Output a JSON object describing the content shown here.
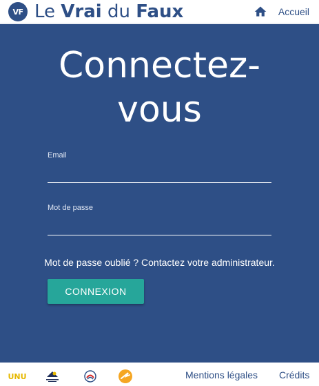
{
  "header": {
    "logo_mark": "VF",
    "brand_part1": "Le ",
    "brand_part2": "Vrai",
    "brand_part3": " du ",
    "brand_part4": "Faux",
    "home_icon": "home-icon",
    "home_label": "Accueil"
  },
  "main": {
    "title_line1": "Connectez-",
    "title_line2": "vous",
    "email_label": "Email",
    "email_value": "",
    "password_label": "Mot de passe",
    "password_value": "",
    "forgot_text": "Mot de passe oublié ? Contactez votre administrateur.",
    "submit_label": "CONNEXION"
  },
  "footer": {
    "partner_logos": [
      "unu-logo",
      "partner-logo-2",
      "partner-logo-3",
      "partner-logo-4"
    ],
    "partner_unu_text": "UNU",
    "legal_link": "Mentions légales",
    "credits_link": "Crédits"
  },
  "colors": {
    "primary": "#2e4f86",
    "button": "#26a69a",
    "background": "#ffffff"
  }
}
